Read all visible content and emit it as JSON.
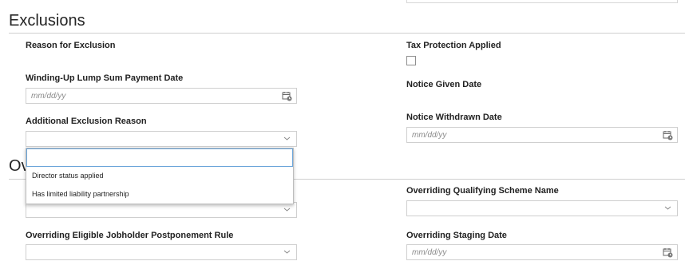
{
  "exclusions": {
    "title": "Exclusions",
    "reason_label": "Reason for Exclusion",
    "tax_protection_label": "Tax Protection Applied",
    "winding_up_label": "Winding-Up Lump Sum Payment Date",
    "winding_up_placeholder": "mm/dd/yy",
    "notice_given_label": "Notice Given Date",
    "additional_reason_label": "Additional Exclusion Reason",
    "notice_withdrawn_label": "Notice Withdrawn Date",
    "notice_withdrawn_placeholder": "mm/dd/yy",
    "dropdown_options": [
      "Director status applied",
      "Has limited liability partnership"
    ]
  },
  "overriding": {
    "title_visible": "Ov",
    "qualifying_scheme_label": "Overriding Qualifying Scheme Name",
    "postponement_label": "Overriding Eligible Jobholder Postponement Rule",
    "staging_date_label": "Overriding Staging Date",
    "staging_date_placeholder": "mm/dd/yy"
  },
  "colors": {
    "border": "#cfcfcf",
    "dropdown_highlight": "#6aa4d9",
    "placeholder": "#8a8a8a"
  },
  "icons": {
    "calendar": "calendar-icon",
    "chevron": "chevron-down-icon"
  }
}
